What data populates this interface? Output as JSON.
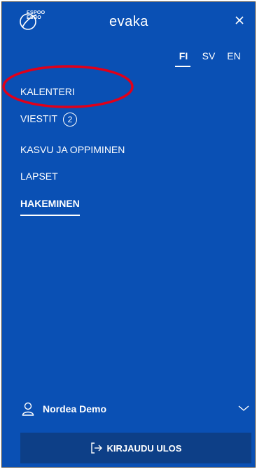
{
  "header": {
    "logo_line1": "ESPOO",
    "logo_line2": "ESBO",
    "brand": "evaka",
    "close_icon": "close-icon"
  },
  "languages": [
    {
      "code": "FI",
      "active": true
    },
    {
      "code": "SV",
      "active": false
    },
    {
      "code": "EN",
      "active": false
    }
  ],
  "nav": {
    "items": [
      {
        "label": "KALENTERI"
      },
      {
        "label": "VIESTIT",
        "badge": "2"
      },
      {
        "label": "KASVU JA OPPIMINEN"
      },
      {
        "label": "LAPSET"
      },
      {
        "label": "HAKEMINEN",
        "active": true
      }
    ]
  },
  "user": {
    "name": "Nordea Demo",
    "icon": "user-icon",
    "chevron": "chevron-down-icon"
  },
  "logout": {
    "label": "KIRJAUDU ULOS",
    "icon": "logout-icon"
  },
  "colors": {
    "background": "#0a50b4",
    "logout_background": "#0d3f87",
    "annotation": "#e0001a"
  }
}
